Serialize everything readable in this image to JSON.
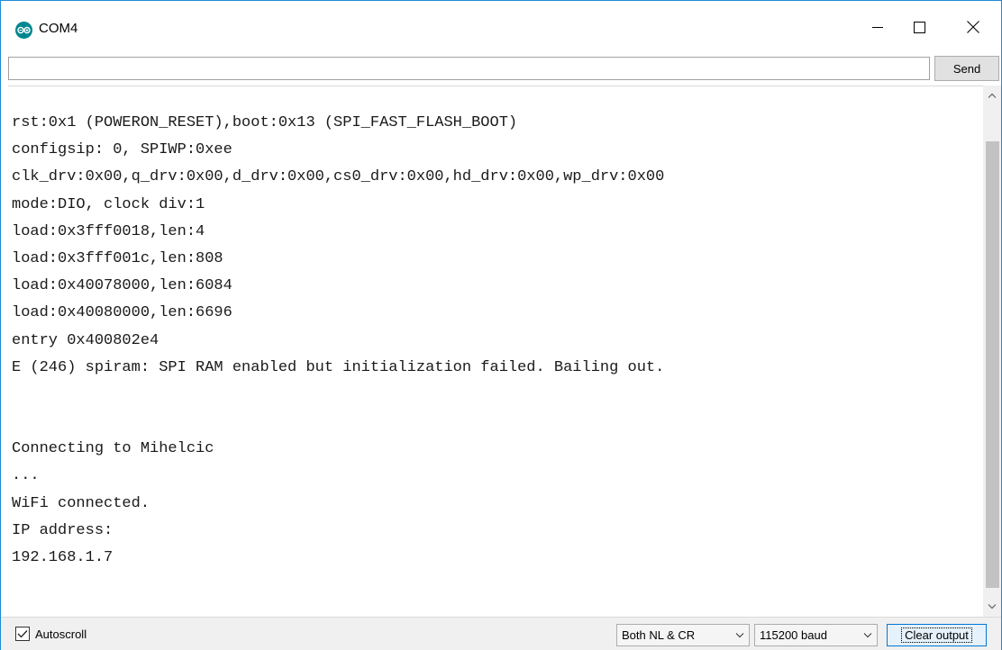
{
  "window": {
    "title": "COM4"
  },
  "send_bar": {
    "input_value": "",
    "send_label": "Send"
  },
  "output": {
    "lines": [
      "rst:0x1 (POWERON_RESET),boot:0x13 (SPI_FAST_FLASH_BOOT)",
      "configsip: 0, SPIWP:0xee",
      "clk_drv:0x00,q_drv:0x00,d_drv:0x00,cs0_drv:0x00,hd_drv:0x00,wp_drv:0x00",
      "mode:DIO, clock div:1",
      "load:0x3fff0018,len:4",
      "load:0x3fff001c,len:808",
      "load:0x40078000,len:6084",
      "load:0x40080000,len:6696",
      "entry 0x400802e4",
      "E (246) spiram: SPI RAM enabled but initialization failed. Bailing out.",
      "",
      "",
      "Connecting to Mihelcic",
      "...",
      "WiFi connected.",
      "IP address:",
      "192.168.1.7"
    ]
  },
  "bottom_bar": {
    "autoscroll_label": "Autoscroll",
    "autoscroll_checked": true,
    "line_ending_value": "Both NL & CR",
    "baud_value": "115200 baud",
    "clear_label": "Clear output"
  },
  "colors": {
    "accent": "#0078d7",
    "app_icon": "#00878f",
    "window_border": "#1f8bd6"
  }
}
